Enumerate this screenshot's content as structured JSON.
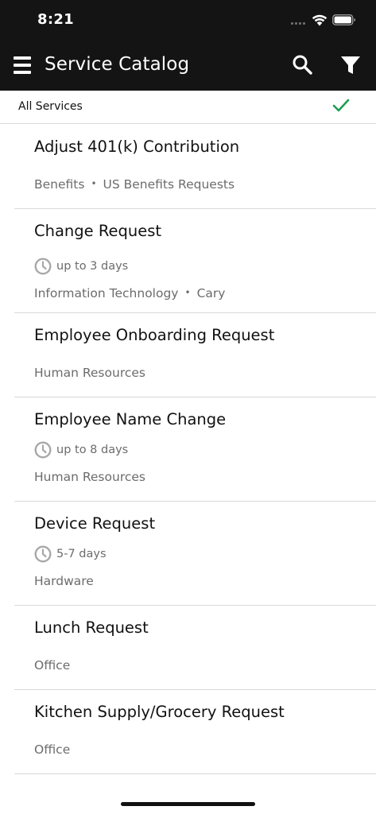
{
  "status_bar": {
    "time": "8:21"
  },
  "nav": {
    "title": "Service Catalog"
  },
  "filter": {
    "label": "All Services"
  },
  "items": [
    {
      "title": "Adjust 401(k) Contribution",
      "duration": "",
      "meta": [
        "Benefits",
        "US Benefits Requests"
      ]
    },
    {
      "title": "Change Request",
      "duration": "up to 3 days",
      "meta": [
        "Information Technology",
        "Cary"
      ]
    },
    {
      "title": "Employee Onboarding Request",
      "duration": "",
      "meta": [
        "Human Resources"
      ]
    },
    {
      "title": "Employee Name Change",
      "duration": "up to 8 days",
      "meta": [
        "Human Resources"
      ]
    },
    {
      "title": "Device Request",
      "duration": "5-7 days",
      "meta": [
        "Hardware"
      ]
    },
    {
      "title": "Lunch Request",
      "duration": "",
      "meta": [
        "Office"
      ]
    },
    {
      "title": "Kitchen Supply/Grocery Request",
      "duration": "",
      "meta": [
        "Office"
      ]
    }
  ],
  "colors": {
    "bar": "#141414",
    "check": "#1e9e52",
    "muted": "#6c6c6c"
  }
}
